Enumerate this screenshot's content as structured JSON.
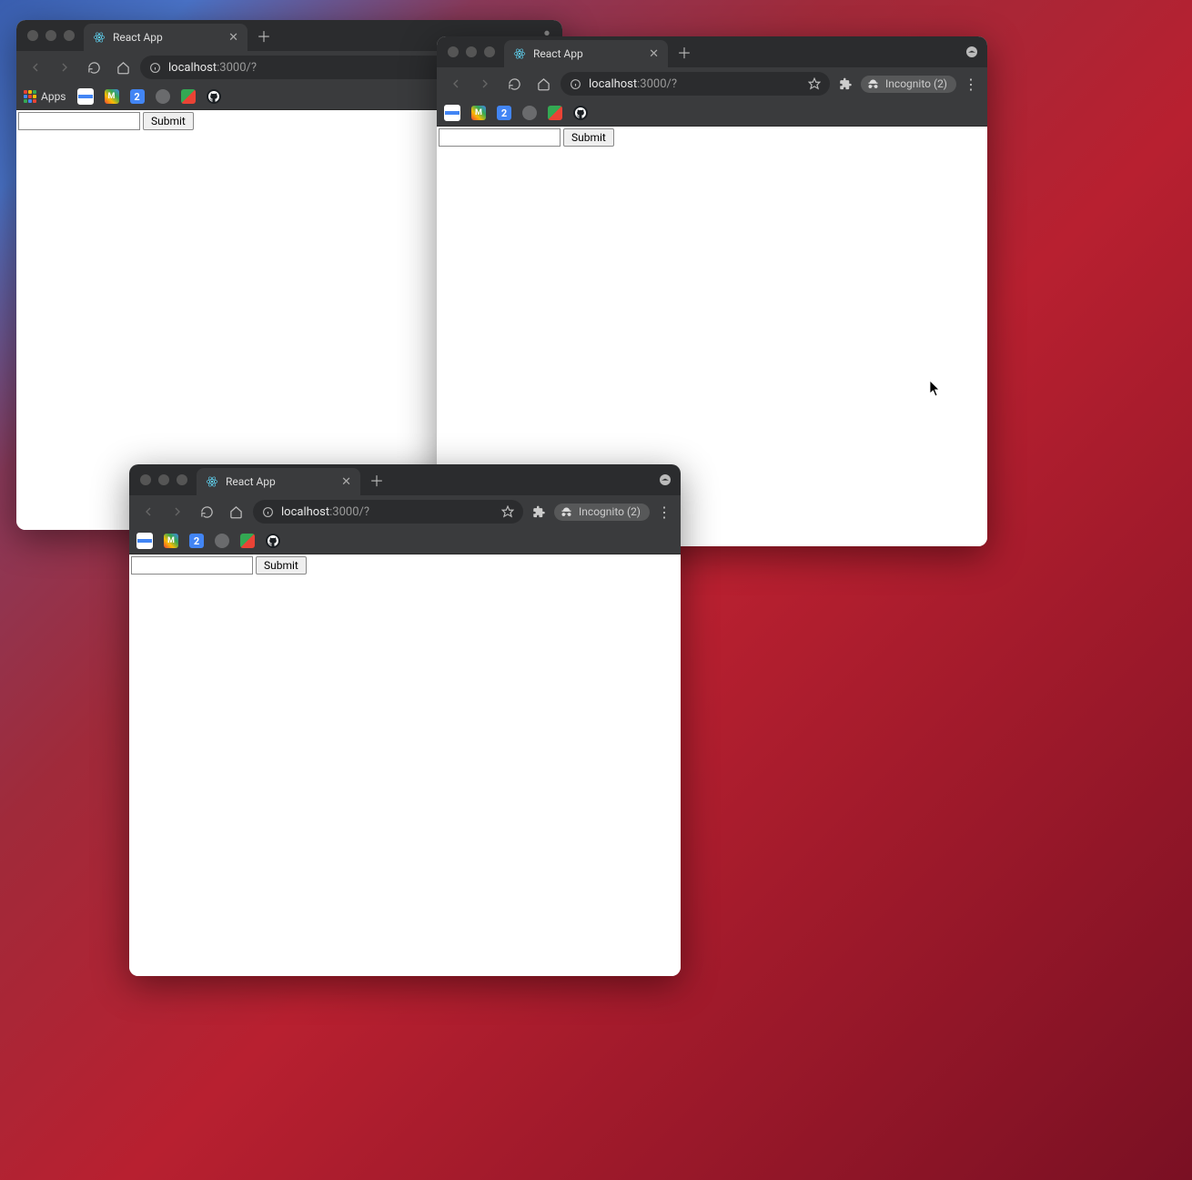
{
  "windows": [
    {
      "id": "win1",
      "tab_title": "React App",
      "url_host": "localhost",
      "url_rest": ":3000/?",
      "bookmarks_apps_label": "Apps",
      "submit_label": "Submit",
      "incognito": false
    },
    {
      "id": "win2",
      "tab_title": "React App",
      "url_host": "localhost",
      "url_rest": ":3000/?",
      "submit_label": "Submit",
      "incognito": true,
      "incognito_label": "Incognito (2)"
    },
    {
      "id": "win3",
      "tab_title": "React App",
      "url_host": "localhost",
      "url_rest": ":3000/?",
      "submit_label": "Submit",
      "incognito": true,
      "incognito_label": "Incognito (2)"
    }
  ]
}
